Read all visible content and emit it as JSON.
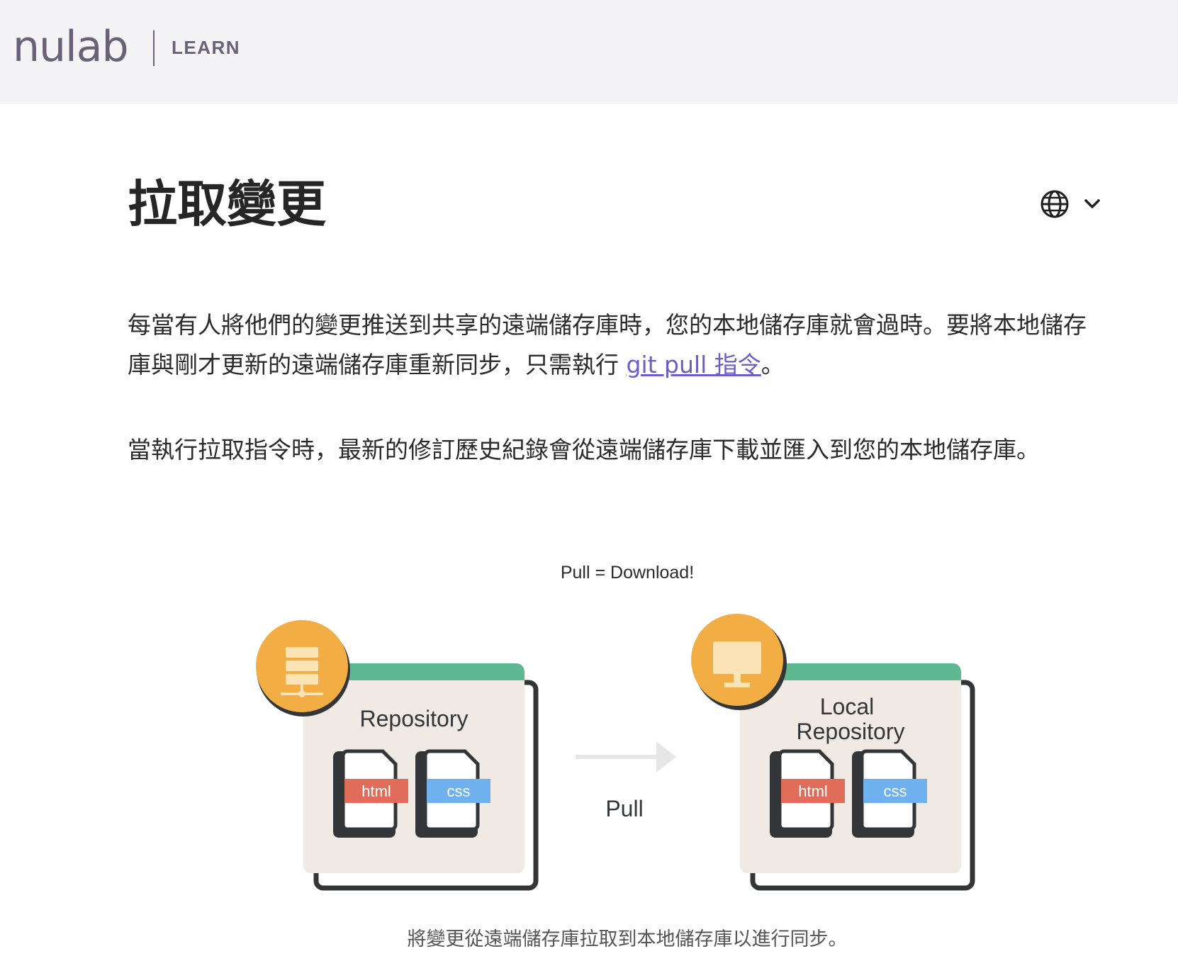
{
  "header": {
    "logo_text": "nulab",
    "section_label": "LEARN"
  },
  "article": {
    "title": "拉取變更",
    "paragraph1_before_link": "每當有人將他們的變更推送到共享的遠端儲存庫時，您的本地儲存庫就會過時。要將本地儲存庫與剛才更新的遠端儲存庫重新同步，只需執行 ",
    "paragraph1_link": "git pull 指令",
    "paragraph1_after_link": "。",
    "paragraph2": "當執行拉取指令時，最新的修訂歷史紀錄會從遠端儲存庫下載並匯入到您的本地儲存庫。"
  },
  "language_switcher": {
    "icon": "globe-icon",
    "caret_icon": "chevron-down-icon"
  },
  "figure": {
    "title": "Pull = Download!",
    "remote_label": "Repository",
    "local_label_line1": "Local",
    "local_label_line2": "Repository",
    "file_html": "html",
    "file_css": "css",
    "arrow_label": "Pull",
    "caption": "將變更從遠端儲存庫拉取到本地儲存庫以進行同步。"
  },
  "colors": {
    "header_bg": "#f4f4f6",
    "brand_gray": "#6a6178",
    "link": "#6c5ec6",
    "card_bg": "#f0e9e4",
    "card_top": "#5fb892",
    "badge_orange": "#f2ae44",
    "html_tag": "#e06c5a",
    "css_tag": "#6fb0ef",
    "outline_dark": "#333638"
  }
}
